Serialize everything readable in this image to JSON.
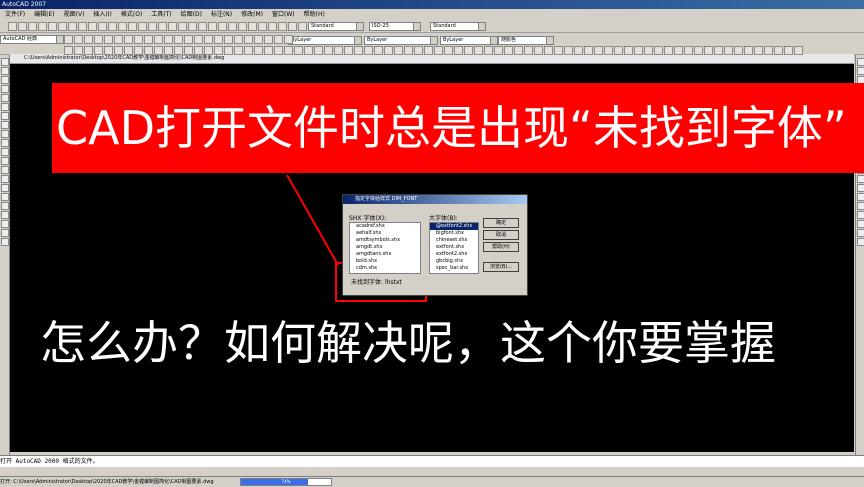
{
  "window": {
    "title": "AutoCAD 2007"
  },
  "menu": [
    "文件(F)",
    "编辑(E)",
    "视图(V)",
    "插入(I)",
    "格式(O)",
    "工具(T)",
    "绘图(D)",
    "标注(N)",
    "修改(M)",
    "窗口(W)",
    "帮助(H)"
  ],
  "toolbar": {
    "text_style": "Standard",
    "dim_style": "ISO-25",
    "table_style": "Standard",
    "workspace": "AutoCAD 经典",
    "layer_color": "ByLayer",
    "layer_linetype": "ByLayer",
    "layer_lineweight": "ByLayer",
    "plot_style": "随颜色"
  },
  "drawing": {
    "path": "C:\\Users\\Administrator\\Desktop\\2020年CAD教学\\金螳螂制图简化\\CAD制图要素.dwg"
  },
  "banner": {
    "text": "CAD打开文件时总是出现“未找到字体”"
  },
  "bottom_caption": {
    "text": "怎么办？如何解决呢，这个你要掌握"
  },
  "dialog": {
    "title": "指定字体给样式 DIM_FONT",
    "shx_label": "SHX 字体(X):",
    "shx_fonts": [
      "acadref.shx",
      "aehalf.shx",
      "amdtsymbols.shx",
      "amgdt.shx",
      "amgdtans.shx",
      "bold.shx",
      "cdm.shx"
    ],
    "big_label": "大字体(B):",
    "big_fonts": [
      "@extfont2.shx",
      "bigfont.shx",
      "chineset.shx",
      "extfont.shx",
      "extfont2.shx",
      "gbcbig.shx",
      "spec_bar.shx"
    ],
    "buttons": {
      "ok": "确定",
      "cancel": "取消",
      "help": "帮助(H)",
      "browse": "浏览(B)..."
    },
    "missing_label": "未找到字体: ",
    "missing_font": "lhstxt"
  },
  "command": {
    "text": "打开 AutoCAD 2000 格式的文件。"
  },
  "status": {
    "text": "打开: C:\\Users\\Administrator\\Desktop\\2020年CAD教学\\金螳螂制图简化\\CAD制图要素.dwg",
    "progress": 0.74,
    "progress_label": "74%"
  },
  "colors": {
    "banner": "#ff0000",
    "canvas": "#000000",
    "title_bar": "#0a246a",
    "annotation": "#ff0000"
  }
}
